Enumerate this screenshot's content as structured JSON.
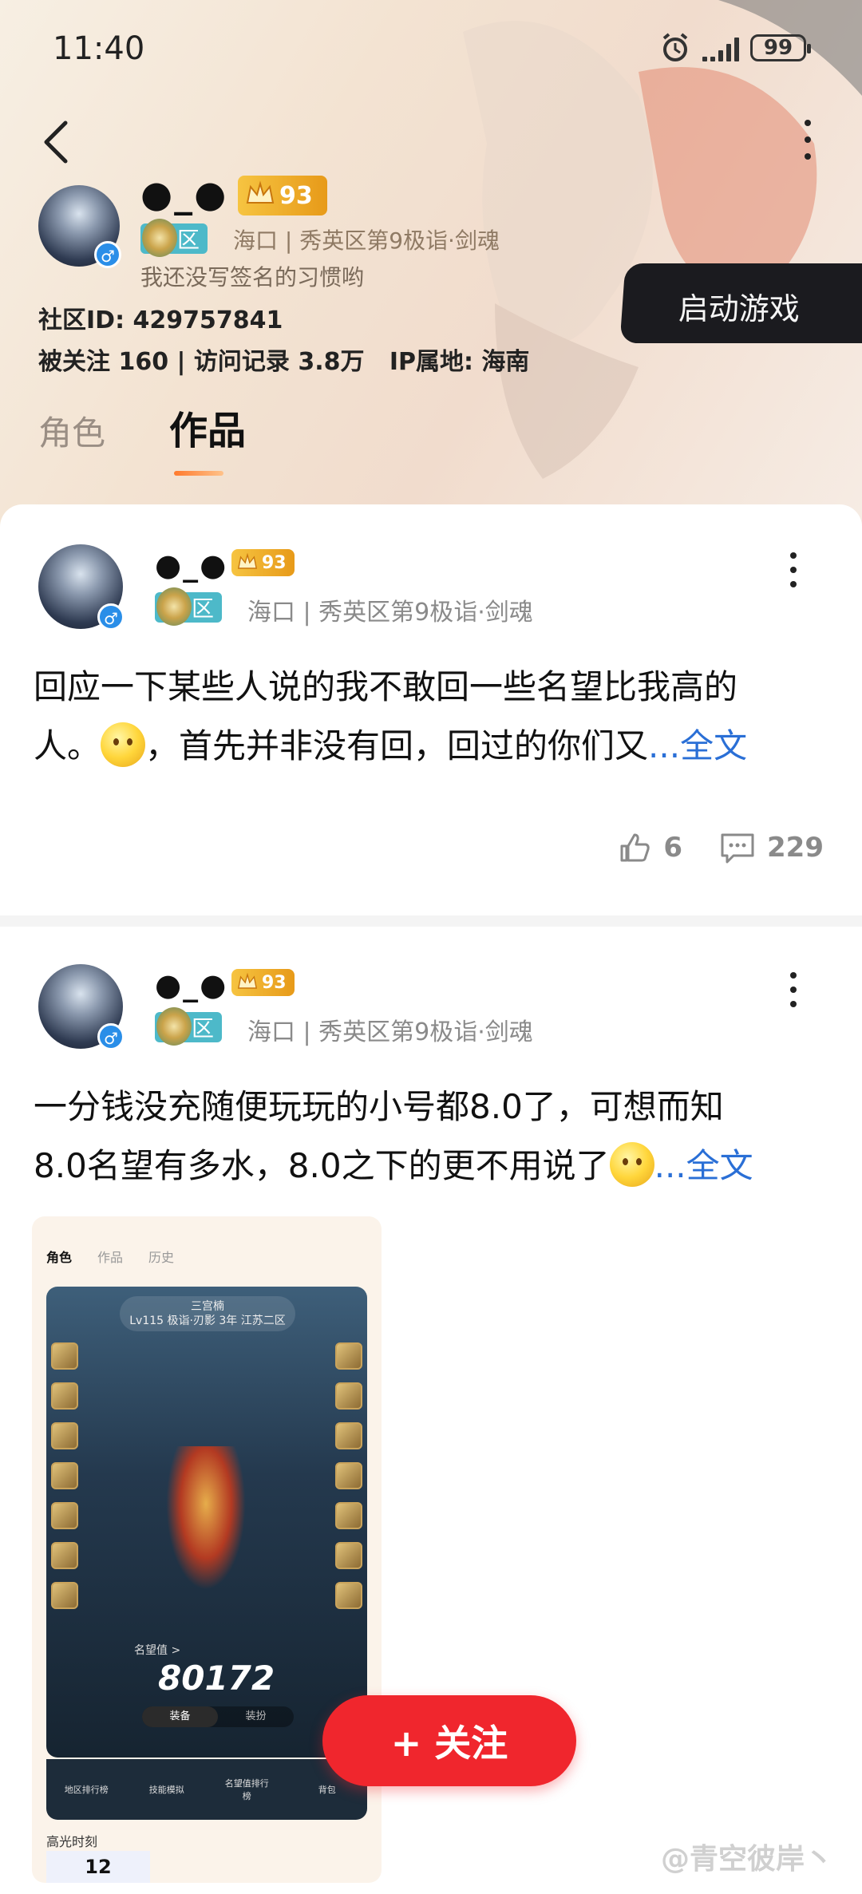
{
  "status_bar": {
    "time": "11:40",
    "battery": "99"
  },
  "profile": {
    "nickname": "●_●",
    "level": "93",
    "zone_badge": "区",
    "zone_info": "海口 | 秀英区第9极诣·剑魂",
    "signature": "我还没写签名的习惯哟",
    "community_id": "社区ID: 429757841",
    "stats": "被关注 160 | 访问记录 3.8万   IP属地: 海南"
  },
  "launch_game": "启动游戏",
  "tabs": [
    {
      "label": "角色"
    },
    {
      "label": "作品"
    }
  ],
  "posts": [
    {
      "nickname": "●_●",
      "level": "93",
      "zone_badge": "区",
      "zone_info": "海口 | 秀英区第9极诣·剑魂",
      "text_line1": "回应一下某些人说的我不敢回一些名望比我高的",
      "text_line2_a": "人。",
      "text_line2_b": "，首先并非没有回，回过的你们又",
      "more": "...全文",
      "likes": "6",
      "comments": "229"
    },
    {
      "nickname": "●_●",
      "level": "93",
      "zone_badge": "区",
      "zone_info": "海口 | 秀英区第9极诣·剑魂",
      "text_line1": "一分钱没充随便玩玩的小号都8.0了，可想而知",
      "text_line2_a": "8.0名望有多水，8.0之下的更不用说了",
      "more": "...全文"
    }
  ],
  "thumbnail": {
    "tabs": [
      "角色",
      "作品",
      "历史"
    ],
    "char_name": "三宫楠",
    "char_info": "Lv115 极诣·刃影 3年 江苏二区",
    "score_label": "名望值 >",
    "score": "80172",
    "switch": [
      "装备",
      "装扮"
    ],
    "nav": [
      "地区排行榜",
      "技能模拟",
      "名望值排行榜",
      "背包"
    ],
    "highlight": "高光时刻",
    "highlight_value": "12"
  },
  "follow_button": "+ 关注",
  "watermark": "@青空彼岸丶"
}
